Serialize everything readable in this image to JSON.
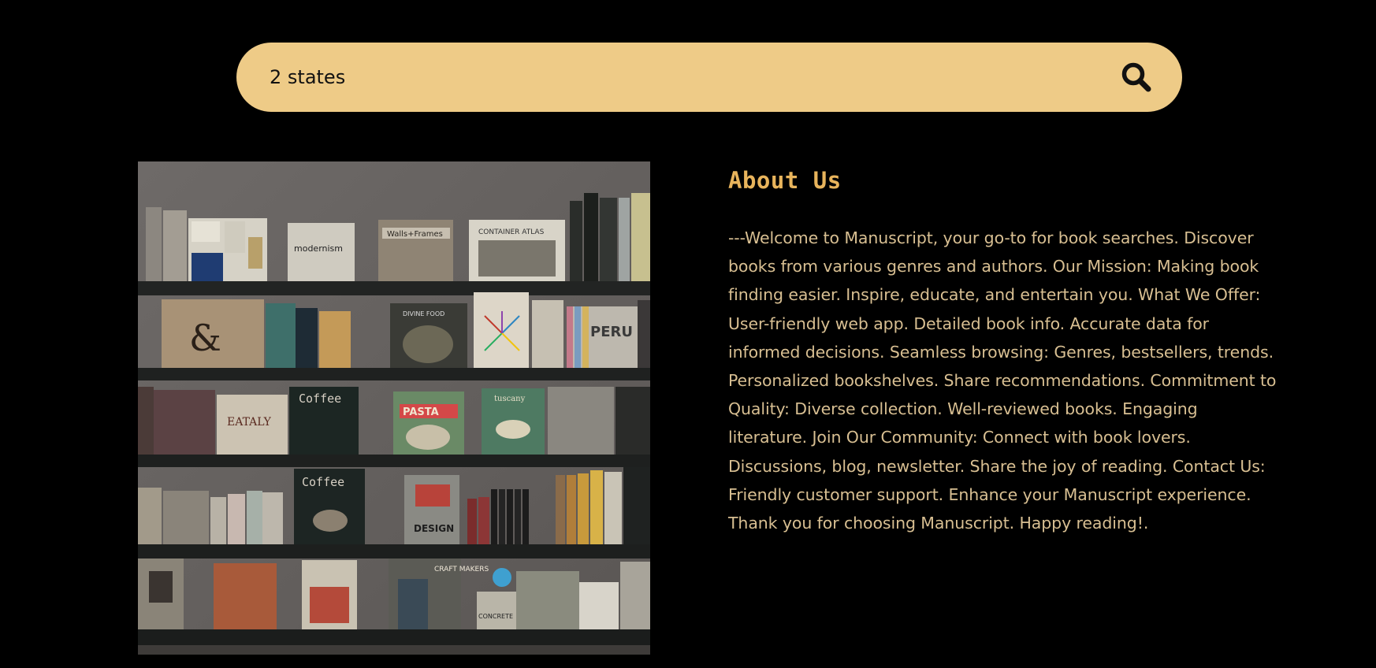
{
  "search": {
    "value": "2 states",
    "icon": "search-icon"
  },
  "image": {
    "subject": "bookshelf",
    "book_titles": {
      "walls_frames": "Walls+Frames",
      "container_atlas": "CONTAINER ATLAS",
      "modernism": "modernism",
      "peru": "PERU",
      "coffee_1": "Coffee",
      "coffee_2": "Coffee",
      "eataly": "EATALY",
      "pasta": "PASTA",
      "tuscany": "tuscany",
      "design_book": "DESIGN",
      "craft_makers": "CRAFT MAKERS",
      "concrete": "CONCRETE"
    }
  },
  "about": {
    "title": "About Us",
    "body": "---Welcome to Manuscript, your go-to for book searches. Discover books from various genres and authors. Our Mission: Making book finding easier. Inspire, educate, and entertain you. What We Offer: User-friendly web app. Detailed book info. Accurate data for informed decisions. Seamless browsing: Genres, bestsellers, trends. Personalized bookshelves. Share recommendations. Commitment to Quality: Diverse collection. Well-reviewed books. Engaging literature. Join Our Community: Connect with book lovers. Discussions, blog, newsletter. Share the joy of reading. Contact Us: Friendly customer support. Enhance your Manuscript experience. Thank you for choosing Manuscript. Happy reading!."
  },
  "colors": {
    "background": "#000000",
    "search_bar": "#eecb87",
    "title": "#e8b45c",
    "body_text": "#d8bf92"
  }
}
